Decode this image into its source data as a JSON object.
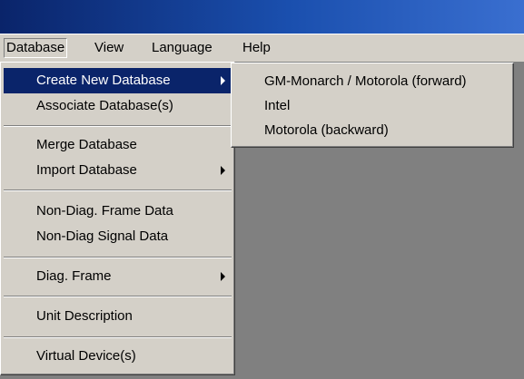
{
  "menubar": {
    "items": [
      {
        "label": "Database",
        "open": true
      },
      {
        "label": "View"
      },
      {
        "label": "Language"
      },
      {
        "label": "Help"
      }
    ]
  },
  "database_menu": {
    "items": [
      {
        "label": "Create New Database",
        "submenu": true,
        "highlighted": true
      },
      {
        "label": "Associate Database(s)"
      },
      {
        "separator": true
      },
      {
        "label": "Merge Database"
      },
      {
        "label": "Import Database",
        "submenu": true
      },
      {
        "separator": true
      },
      {
        "label": "Non-Diag. Frame Data"
      },
      {
        "label": "Non-Diag Signal Data"
      },
      {
        "separator": true
      },
      {
        "label": "Diag. Frame",
        "submenu": true
      },
      {
        "separator": true
      },
      {
        "label": "Unit Description"
      },
      {
        "separator": true
      },
      {
        "label": "Virtual Device(s)"
      }
    ]
  },
  "create_submenu": {
    "items": [
      {
        "label": "GM-Monarch / Motorola (forward)"
      },
      {
        "label": "Intel"
      },
      {
        "label": "Motorola (backward)"
      }
    ]
  },
  "colors": {
    "menu_face": "#d4d0c8",
    "highlight": "#0a246a",
    "workspace": "#808080",
    "titlebar_gradient": [
      "#0a246a",
      "#3a6fd0"
    ]
  }
}
